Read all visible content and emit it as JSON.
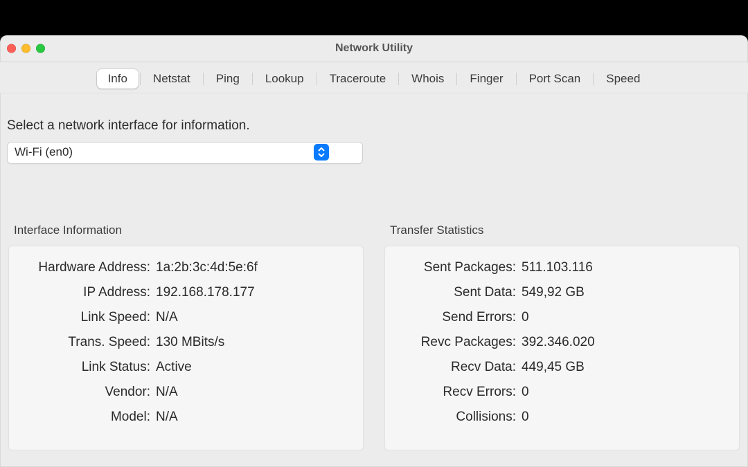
{
  "window": {
    "title": "Network Utility"
  },
  "tabs": [
    {
      "label": "Info",
      "active": true
    },
    {
      "label": "Netstat",
      "active": false
    },
    {
      "label": "Ping",
      "active": false
    },
    {
      "label": "Lookup",
      "active": false
    },
    {
      "label": "Traceroute",
      "active": false
    },
    {
      "label": "Whois",
      "active": false
    },
    {
      "label": "Finger",
      "active": false
    },
    {
      "label": "Port Scan",
      "active": false
    },
    {
      "label": "Speed",
      "active": false
    }
  ],
  "prompt": "Select a network interface for information.",
  "interface_select": {
    "value": "Wi-Fi (en0)"
  },
  "sections": {
    "interface": {
      "title": "Interface Information",
      "rows": [
        {
          "label": "Hardware Address:",
          "value": "1a:2b:3c:4d:5e:6f"
        },
        {
          "label": "IP Address:",
          "value": "192.168.178.177"
        },
        {
          "label": "Link Speed:",
          "value": "N/A"
        },
        {
          "label": "Trans. Speed:",
          "value": "130 MBits/s"
        },
        {
          "label": "Link Status:",
          "value": "Active"
        },
        {
          "label": "Vendor:",
          "value": "N/A"
        },
        {
          "label": "Model:",
          "value": "N/A"
        }
      ]
    },
    "transfer": {
      "title": "Transfer Statistics",
      "rows": [
        {
          "label": "Sent Packages:",
          "value": "511.103.116"
        },
        {
          "label": "Sent Data:",
          "value": "549,92 GB"
        },
        {
          "label": "Send Errors:",
          "value": "0"
        },
        {
          "label": "Revc Packages:",
          "value": "392.346.020"
        },
        {
          "label": "Recv Data:",
          "value": "449,45 GB"
        },
        {
          "label": "Recv Errors:",
          "value": "0"
        },
        {
          "label": "Collisions:",
          "value": "0"
        }
      ]
    }
  }
}
